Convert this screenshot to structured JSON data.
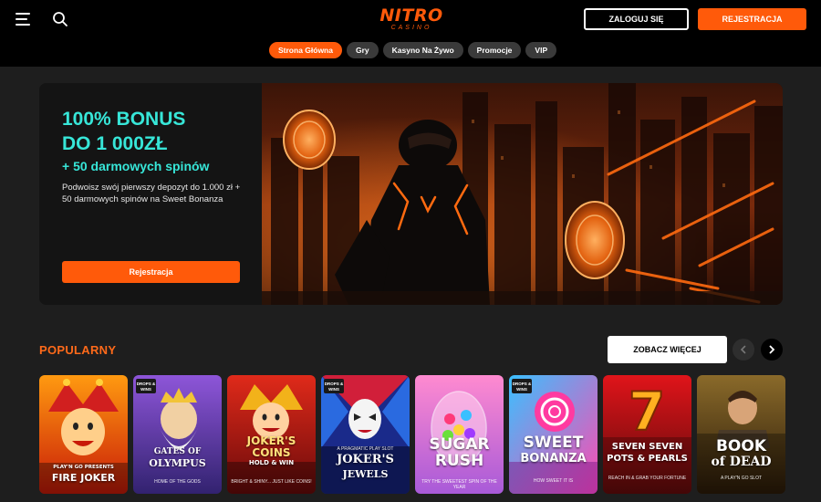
{
  "header": {
    "logo_main": "NITRO",
    "logo_sub": "CASINO",
    "login_label": "ZALOGUJ SIĘ",
    "register_label": "REJESTRACJA",
    "icons": {
      "menu": "hamburger-menu-icon",
      "search": "search-icon"
    }
  },
  "nav": {
    "items": [
      {
        "label": "Strona Główna",
        "active": true
      },
      {
        "label": "Gry",
        "active": false
      },
      {
        "label": "Kasyno Na Żywo",
        "active": false
      },
      {
        "label": "Promocje",
        "active": false
      },
      {
        "label": "VIP",
        "active": false
      }
    ]
  },
  "hero": {
    "title_line1": "100% BONUS",
    "title_line2": "DO 1 000ZŁ",
    "subtitle": "+ 50 darmowych spinów",
    "description": "Podwoisz swój pierwszy depozyt do 1.000 zł + 50 darmowych spinów na Sweet Bonanza",
    "cta_label": "Rejestracja"
  },
  "popular": {
    "title": "POPULARNY",
    "more_label": "ZOBACZ WIĘCEJ",
    "prev_icon": "chevron-left-icon",
    "next_icon": "chevron-right-icon",
    "games": [
      {
        "line1": "PLAY'N GO PRESENTS",
        "line2": "FIRE JOKER",
        "tag": "",
        "badge": ""
      },
      {
        "line1": "GATES OF",
        "line2": "OLYMPUS",
        "tag": "HOME OF THE GODS",
        "badge": "DROPS & WINS"
      },
      {
        "line1": "JOKER'S",
        "line2": "COINS",
        "tag": "BRIGHT & SHINY... JUST LIKE COINS!",
        "extra": "HOLD & WIN",
        "badge": ""
      },
      {
        "line1": "JOKER'S",
        "line2": "JEWELS",
        "tag": "A PRAGMATIC PLAY SLOT",
        "badge": "DROPS & WINS"
      },
      {
        "line1": "SUGAR",
        "line2": "RUSH",
        "tag": "TRY THE SWEETEST SPIN OF THE YEAR",
        "badge": ""
      },
      {
        "line1": "SWEET",
        "line2": "BONANZA",
        "tag": "HOW SWEET IT IS",
        "badge": "DROPS & WINS"
      },
      {
        "line1": "SEVEN SEVEN",
        "line2": "POTS & PEARLS",
        "tag": "REACH IN & GRAB YOUR FORTUNE",
        "badge": ""
      },
      {
        "line1": "BOOK",
        "line2": "of DEAD",
        "tag": "A PLAY'N GO SLOT",
        "badge": ""
      }
    ]
  },
  "colors": {
    "accent": "#ff5a0a",
    "hero_text": "#37e6d8",
    "page_bg": "#1e1e1e",
    "header_bg": "#000000"
  }
}
